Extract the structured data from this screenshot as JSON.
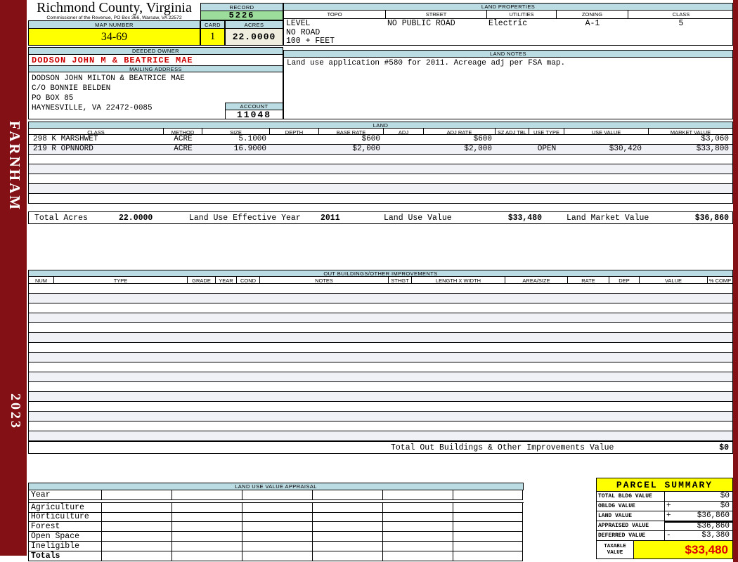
{
  "sidebar": {
    "district": "FARNHAM",
    "year": "2023"
  },
  "header": {
    "county": "Richmond County, Virginia",
    "commissioner": "Commissioner of the Revenue, PO Box 366, Warsaw, VA 22572",
    "record_label": "RECORD",
    "record": "5226",
    "map_number_label": "MAP NUMBER",
    "map_number": "34-69",
    "card_label": "CARD",
    "card": "1",
    "acres_label": "ACRES",
    "acres": "22.0000"
  },
  "land_properties": {
    "title": "LAND PROPERTIES",
    "columns": [
      "TOPO",
      "STREET",
      "UTILITIES",
      "ZONING",
      "CLASS"
    ],
    "topo_lines": [
      "LEVEL",
      "NO ROAD",
      "100 + FEET"
    ],
    "street": "NO PUBLIC ROAD",
    "utilities": "Electric",
    "zoning": "A-1",
    "class": "5"
  },
  "owner": {
    "deeded_owner_label": "DEEDED OWNER",
    "deeded_owner": "DODSON JOHN M & BEATRICE MAE",
    "mailing_address_label": "MAILING ADDRESS",
    "mailing_address_lines": [
      "DODSON JOHN MILTON & BEATRICE MAE",
      "C/O BONNIE BELDEN",
      "PO BOX 85",
      "HAYNESVILLE, VA 22472-0085"
    ],
    "account_label": "ACCOUNT",
    "account": "11048"
  },
  "land_notes": {
    "title": "LAND NOTES",
    "text": "Land use application #580 for 2011. Acreage adj per FSA map."
  },
  "land": {
    "title": "LAND",
    "columns": [
      "CLASS",
      "METHOD",
      "SIZE",
      "DEPTH",
      "BASE RATE",
      "ADJ",
      "ADJ RATE",
      "SZ ADJ TBL",
      "USE TYPE",
      "USE VALUE",
      "MARKET VALUE"
    ],
    "rows": [
      {
        "class": "298 K MARSHWET",
        "method": "ACRE",
        "size": "5.1000",
        "depth": "",
        "base_rate": "$600",
        "adj": "",
        "adj_rate": "$600",
        "sz_adj_tbl": "",
        "use_type": "",
        "use_value": "",
        "market_value": "$3,060"
      },
      {
        "class": "219 R OPNNORD",
        "method": "ACRE",
        "size": "16.9000",
        "depth": "",
        "base_rate": "$2,000",
        "adj": "",
        "adj_rate": "$2,000",
        "sz_adj_tbl": "",
        "use_type": "OPEN",
        "use_value": "$30,420",
        "market_value": "$33,800"
      }
    ],
    "empty_row_count": 5,
    "totals": {
      "total_acres_label": "Total Acres",
      "total_acres": "22.0000",
      "effective_year_label": "Land Use Effective Year",
      "effective_year": "2011",
      "use_value_label": "Land Use Value",
      "use_value": "$33,480",
      "market_value_label": "Land Market Value",
      "market_value": "$36,860"
    }
  },
  "out_buildings": {
    "title": "OUT BUILDINGS/OTHER IMPROVEMENTS",
    "columns": [
      "NUM",
      "TYPE",
      "GRADE",
      "YEAR",
      "COND",
      "NOTES",
      "STHGT",
      "LENGTH X WIDTH",
      "AREA/SIZE",
      "RATE",
      "DEP",
      "VALUE",
      "% COMP"
    ],
    "empty_row_count": 16,
    "total_label": "Total Out Buildings & Other Improvements Value",
    "total_value": "$0"
  },
  "land_use_appraisal": {
    "title": "LAND USE VALUE APPRAISAL",
    "row_labels": [
      "Year",
      "Agriculture",
      "Horticulture",
      "Forest",
      "Open Space",
      "Ineligible",
      "Totals"
    ],
    "column_count": 6
  },
  "parcel_summary": {
    "title": "PARCEL SUMMARY",
    "rows": [
      {
        "label": "TOTAL BLDG VALUE",
        "op": "",
        "value": "$0"
      },
      {
        "label": "OBLDG VALUE",
        "op": "+",
        "value": "$0"
      },
      {
        "label": "LAND VALUE",
        "op": "+",
        "value": "$36,860"
      },
      {
        "label": "APPRAISED VALUE",
        "op": "",
        "value": "$36,860"
      },
      {
        "label": "DEFERRED VALUE",
        "op": "-",
        "value": "$3,380"
      }
    ],
    "taxable_label_line1": "TAXABLE",
    "taxable_label_line2": "VALUE",
    "taxable_value": "$33,480"
  },
  "colors": {
    "frame_maroon": "#821014",
    "band_blue": "#BCDCE4",
    "record_green": "#9CDD9C",
    "highlight_yellow": "#FFFF00",
    "acres_cream": "#F0EFDF",
    "stripe": "#F0F0F7",
    "owner_red": "#CC0000",
    "taxable_red": "#DD0000"
  }
}
